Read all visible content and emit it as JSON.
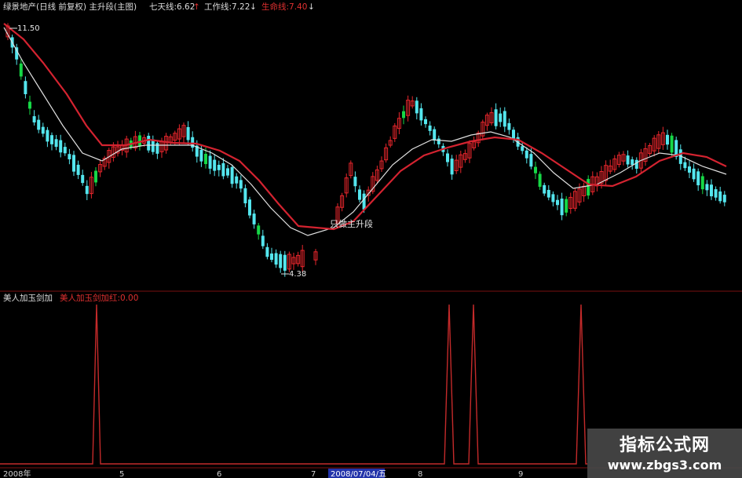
{
  "header": {
    "stock_title": "绿景地产(日线 前复权) 主升段(主图)",
    "seven_day_line": "七天线:6.62",
    "seven_day_arrow": "↑",
    "work_line": "工作线:7.22",
    "work_arrow": "↓",
    "life_line": "生命线:7.40",
    "life_arrow": "↓"
  },
  "annotations": {
    "high_label": "11.50",
    "low_label": "4.38",
    "signal_label": "只做主升段"
  },
  "sub_panel": {
    "title": "美人加玉剑加",
    "indicator": "美人加玉剑加红:0.00"
  },
  "axis": {
    "labels": [
      "2008年",
      "5",
      "6",
      "7",
      "2008/07/04/五",
      "8",
      "9"
    ]
  },
  "watermark": {
    "line1": "指标公式网",
    "line2": "www.zbgs3.com"
  },
  "colors": {
    "up": "#e8262c",
    "down": "#54e6ee",
    "flat_green": "#16d846",
    "ma_red": "#d42330",
    "ma_white": "#e0e0e0",
    "selected_date_bg": "#2233aa"
  }
}
